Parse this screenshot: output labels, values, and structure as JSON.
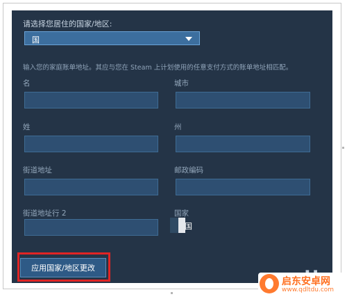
{
  "form": {
    "title": "请选择您居住的国家/地区:",
    "country_value": "国",
    "hint": "输入您的家庭账单地址。其应与您在 Steam 上计划使用的任意支付方式的账单地址相匹配。",
    "labels": {
      "first_name": "名",
      "city": "城市",
      "last_name": "姓",
      "state": "州",
      "street": "街道地址",
      "postal": "邮政编码",
      "street2": "街道地址行 2",
      "country": "国家"
    },
    "country_flag_text": "国",
    "apply_label": "应用国家/地区更改"
  },
  "watermark": {
    "brand": "启东安卓网",
    "url": "www.qdltdu.com"
  }
}
